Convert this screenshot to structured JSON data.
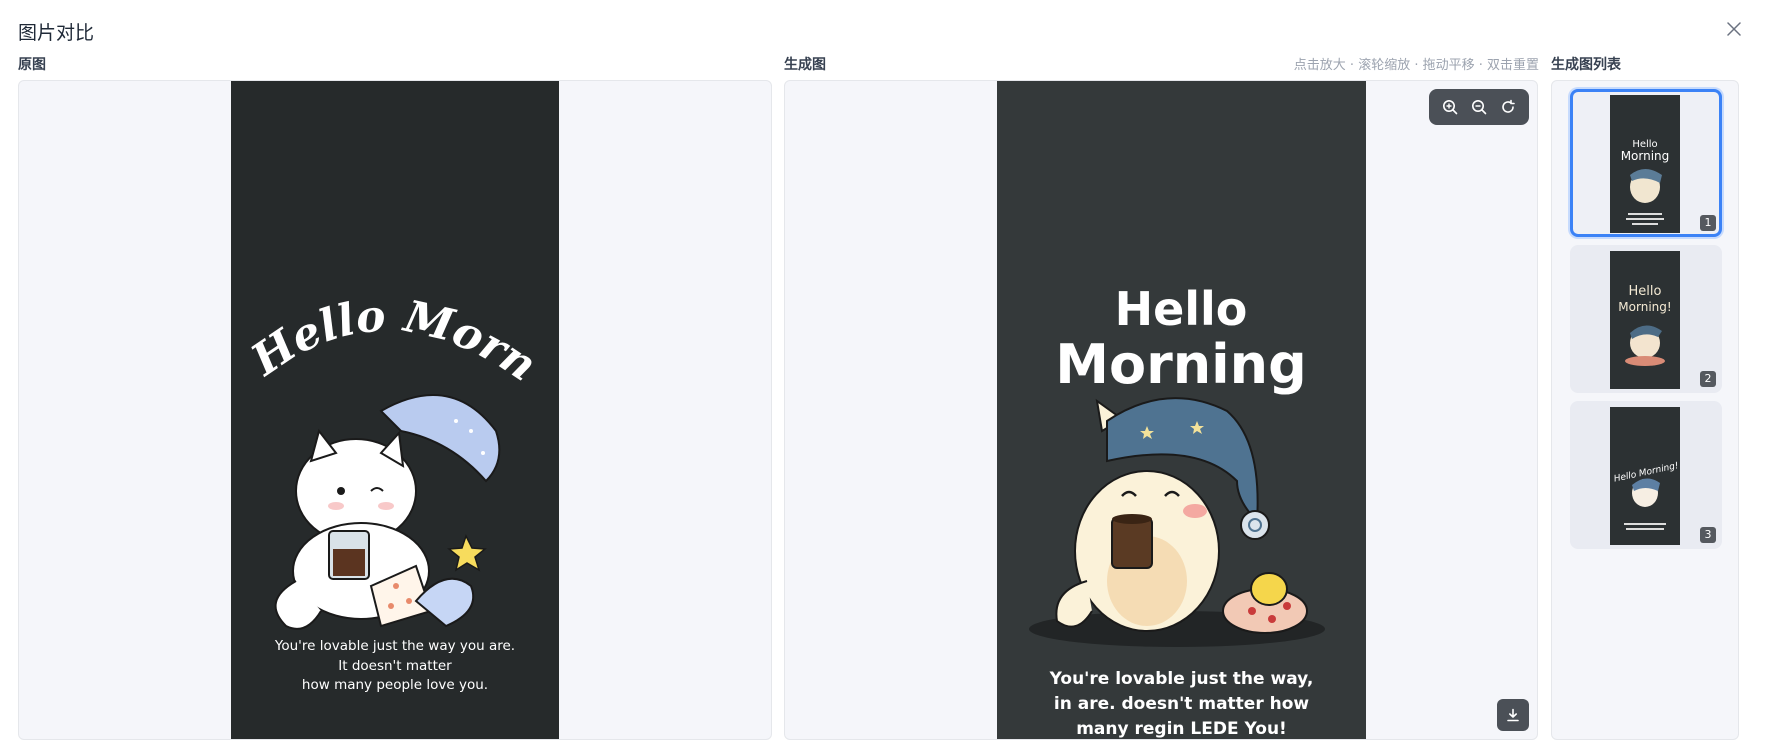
{
  "dialog": {
    "title": "图片对比",
    "close_icon": "close-icon"
  },
  "original": {
    "label": "原图",
    "image_title": "Hello Morning",
    "quote": [
      "You're lovable just the way you are.",
      "It doesn't matter",
      "how many people love you."
    ]
  },
  "generated": {
    "label": "生成图",
    "hint": "点击放大 · 滚轮缩放 · 拖动平移 · 双击重置",
    "image_title_line1": "Hello",
    "image_title_line2": "Morning",
    "quote": [
      "You're lovable just the way,",
      "in are. doesn't matter  how",
      "many regin LEDE You!"
    ],
    "toolbar": {
      "zoom_in_icon": "zoom-in-icon",
      "zoom_out_icon": "zoom-out-icon",
      "reset_icon": "rotate-reset-icon"
    },
    "download_icon": "download-icon"
  },
  "thumbnails": {
    "label": "生成图列表",
    "items": [
      {
        "badge": "1",
        "selected": true,
        "title_line1": "Hello",
        "title_line2": "Morning"
      },
      {
        "badge": "2",
        "selected": false,
        "title_line1": "Hello",
        "title_line2": "Morning!"
      },
      {
        "badge": "3",
        "selected": false,
        "title_line1": "Hello Morning!",
        "title_line2": ""
      }
    ]
  },
  "colors": {
    "accent": "#3b82f6",
    "panel_bg": "#f5f6fa",
    "art_bg": "#262a2b"
  }
}
